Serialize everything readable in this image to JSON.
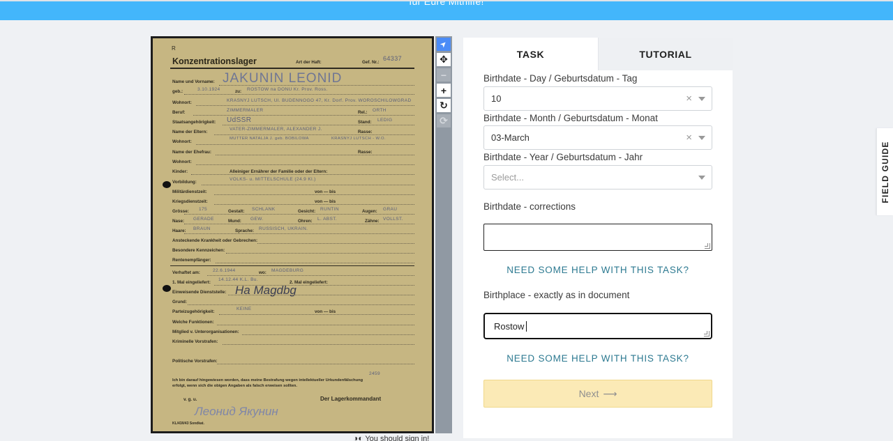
{
  "banner": {
    "text": "für Eure Mithilfe!"
  },
  "document": {
    "header_mark": "R",
    "title": "Konzentrationslager",
    "art_der_haft": "Art der Haft:",
    "gef_nr_label": "Gef. Nr.:",
    "gef_nr_value": "64337",
    "name_label": "Name und Vorname:",
    "name_value": "JAKUNIN  LEONID",
    "geb_label": "geb.:",
    "geb_value": "3.10.1924",
    "geb_in_label": "zu:",
    "geb_in_value": "ROSTOW na DONU  Kr. Prov. Ross.",
    "wohnort_label": "Wohnort:",
    "wohnort_value": "KRASNYJ LUTSCH,  Ul. BUDENNOGO 47, Kr. Dorf. Prov. WOROSCHILOWGRAD",
    "beruf_label": "Beruf:",
    "beruf_value": "ZIMMERMALER",
    "rel_label": "Rel.:",
    "rel_value": "ORTH",
    "staat_label": "Staatsangehörigkeit:",
    "staat_value": "UdSSR",
    "stand_label": "Stand:",
    "stand_value": "LEDIG",
    "eltern_label": "Name der Eltern:",
    "eltern_value": "VATER-ZIMMERMALER, ALEXANDER J.",
    "rasse_label": "Rasse:",
    "eltern_wohnort_label": "Wohnort:",
    "eltern_wohnort_value": "MUTTER NATALJA J. geb. BOBILOWA",
    "eltern_wohnort_value2": "KRASNYJ LUTSCH - W.O.",
    "ehefrau_label": "Name der Ehefrau:",
    "ehefrau_rasse_label": "Rasse:",
    "ehefrau_wohnort_label": "Wohnort:",
    "kinder_label": "Kinder:",
    "ernaehrer_label": "Alleiniger Ernährer der Familie oder der Eltern:",
    "vorbildung_label": "Vorbildung:",
    "vorbildung_value": "VOLKS- u. MITTELSCHULE (24.9 Kl.)",
    "militaer_label": "Militärdienstzeit:",
    "krieg_label": "Kriegsdienstzeit:",
    "von_bis": "von — bis",
    "groesse_label": "Grösse:",
    "groesse_value": "175",
    "gestalt_label": "Gestalt:",
    "gestalt_value": "SCHLANK",
    "gesicht_label": "Gesicht:",
    "gesicht_value": "RUNTIN",
    "augen_label": "Augen:",
    "augen_value": "GRAU",
    "nase_label": "Nase:",
    "nase_value": "GERADE",
    "mund_label": "Mund:",
    "mund_value": "GEW.",
    "ohren_label": "Ohren:",
    "ohren_value": "L. ABST.",
    "zaehne_label": "Zähne:",
    "zaehne_value": "VOLLST.",
    "haare_label": "Haare:",
    "haare_value": "BRAUN",
    "sprache_label": "Sprache:",
    "sprache_value": "RUSSISCH, UKRAIN.",
    "krankheit_label": "Ansteckende Krankheit oder Gebrechen:",
    "kennzeichen_label": "Besondere Kennzeichen:",
    "renten_label": "Rentenempfänger:",
    "verhaftet_label": "Verhaftet am:",
    "verhaftet_value": "22.6.1944",
    "wo_label": "wo:",
    "wo_value": "MAGDEBURG",
    "mal1_label": "1. Mal eingeliefert:",
    "mal1_value": "14.12.44  K.L. Bu.",
    "mal2_label": "2. Mal eingeliefert:",
    "dienststelle_label": "Einweisende Dienststelle:",
    "dienststelle_value": "Ha Magdbg",
    "grund_label": "Grund:",
    "partei_label": "Parteizugehörigkeit:",
    "partei_value": "KEINE",
    "funktionen_label": "Welche Funktionen:",
    "mitglied_label": "Mitglied v. Unterorganisationen:",
    "kriminell_label": "Kriminelle Vorstrafen:",
    "politisch_label": "Politische Vorstrafen:",
    "stamp_number": "2459",
    "notice_line1": "Ich bin darauf hingewiesen worden, dass meine Bestrafung wegen intellektueller Urkundenfälschung",
    "notice_line2": "erfolgt, wenn sich die obigen Angaben als falsch erweisen sollten.",
    "vgu": "v. g. u.",
    "kommandant": "Der Lagerkommandant",
    "signature": "Леонид Якунин",
    "footer_code": "KL/43/I/43  Sondkat."
  },
  "toolbar": {
    "tools": [
      {
        "name": "pointer-tool-button",
        "icon": "pointer-icon",
        "glyph": "➤"
      },
      {
        "name": "pan-tool-button",
        "icon": "move-icon",
        "glyph": "✥"
      },
      {
        "name": "zoom-out-button",
        "icon": "minus-icon",
        "glyph": "−"
      },
      {
        "name": "zoom-in-button",
        "icon": "plus-icon",
        "glyph": "+"
      },
      {
        "name": "rotate-button",
        "icon": "rotate-icon",
        "glyph": "↻"
      },
      {
        "name": "reset-button",
        "icon": "refresh-icon",
        "glyph": "⟳"
      }
    ]
  },
  "below_doc_text": "You should sign in!",
  "tabs": {
    "task": "TASK",
    "tutorial": "TUTORIAL"
  },
  "form": {
    "day_label": "Birthdate - Day / Geburtsdatum - Tag",
    "day_value": "10",
    "month_label": "Birthdate - Month / Geburtsdatum - Monat",
    "month_value": "03-March",
    "year_label": "Birthdate - Year / Geburtsdatum - Jahr",
    "year_placeholder": "Select...",
    "corrections_label": "Birthdate - corrections",
    "corrections_value": "",
    "help_text": "NEED SOME HELP WITH THIS TASK?",
    "birthplace_label": "Birthplace - exactly as in document",
    "birthplace_value": "Rostow",
    "help_text_2": "NEED SOME HELP WITH THIS TASK?",
    "next_label": "Next",
    "next_arrow": "⟶"
  },
  "field_guide": {
    "label": "FIELD GUIDE"
  },
  "colors": {
    "banner": "#43b6fb",
    "paper": "#c6b682",
    "help_link": "#2d7a91",
    "next_button": "#fbeab6",
    "tool_active": "#4b8cf7"
  }
}
